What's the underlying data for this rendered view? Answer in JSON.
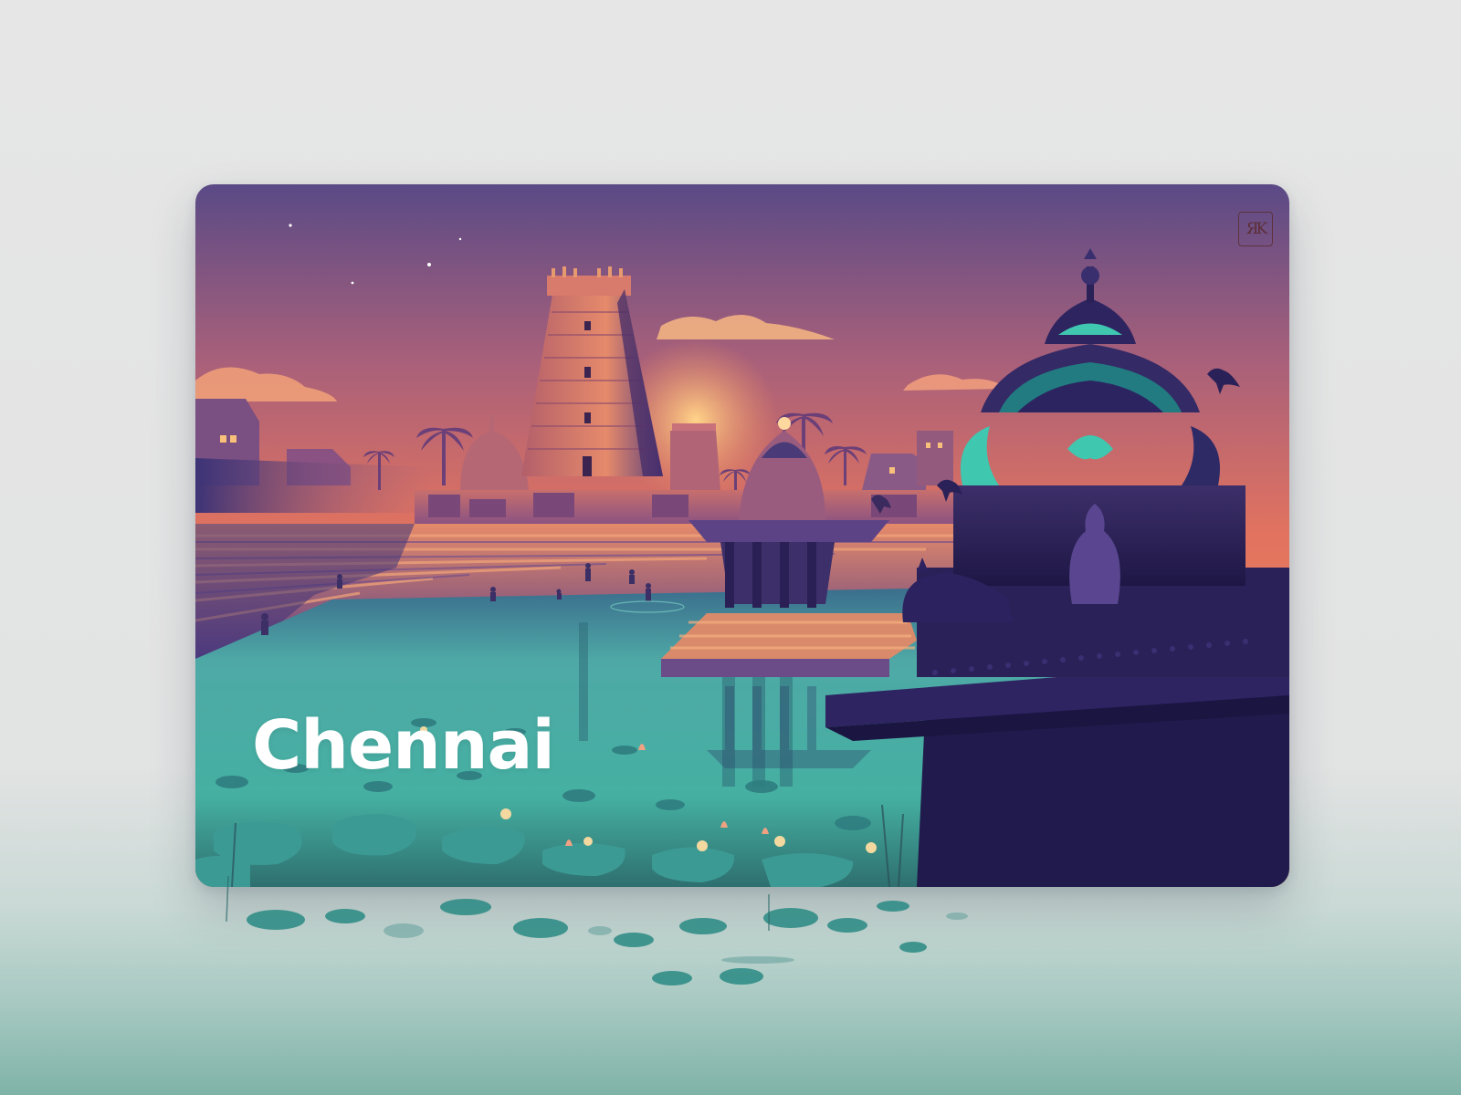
{
  "poster": {
    "city_name": "Chennai",
    "logo_monogram": "RK"
  },
  "colors": {
    "sky_top": "#5a4a86",
    "sky_mid": "#c46e6c",
    "sky_horizon": "#f1825f",
    "water": "#4fb3a8",
    "temple_dark": "#2a1f52",
    "temple_accent": "#3fc7b0"
  }
}
